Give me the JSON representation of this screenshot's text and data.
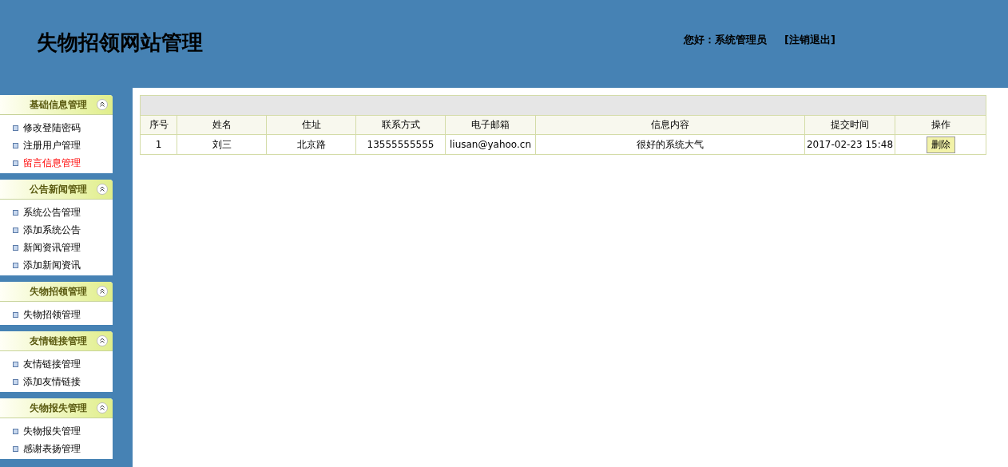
{
  "header": {
    "title": "失物招领网站管理",
    "greeting": "您好：系统管理员",
    "logout": "[注销退出]"
  },
  "sidebar": {
    "sections": [
      {
        "title": "基础信息管理",
        "expanded": true,
        "items": [
          {
            "label": "修改登陆密码",
            "selected": false
          },
          {
            "label": "注册用户管理",
            "selected": false
          },
          {
            "label": "留言信息管理",
            "selected": true
          }
        ]
      },
      {
        "title": "公告新闻管理",
        "expanded": true,
        "items": [
          {
            "label": "系统公告管理",
            "selected": false
          },
          {
            "label": "添加系统公告",
            "selected": false
          },
          {
            "label": "新闻资讯管理",
            "selected": false
          },
          {
            "label": "添加新闻资讯",
            "selected": false
          }
        ]
      },
      {
        "title": "失物招领管理",
        "expanded": true,
        "items": [
          {
            "label": "失物招领管理",
            "selected": false
          }
        ]
      },
      {
        "title": "友情链接管理",
        "expanded": true,
        "items": [
          {
            "label": "友情链接管理",
            "selected": false
          },
          {
            "label": "添加友情链接",
            "selected": false
          }
        ]
      },
      {
        "title": "失物报失管理",
        "expanded": true,
        "items": [
          {
            "label": "失物报失管理",
            "selected": false
          },
          {
            "label": "感谢表扬管理",
            "selected": false
          }
        ]
      }
    ]
  },
  "table": {
    "columns": [
      "序号",
      "姓名",
      "住址",
      "联系方式",
      "电子邮箱",
      "信息内容",
      "提交时间",
      "操作"
    ],
    "rows": [
      {
        "cells": [
          "1",
          "刘三",
          "北京路",
          "13555555555",
          "liusan@yahoo.cn",
          "很好的系统大气",
          "2017-02-23 15:48"
        ],
        "action": "删除"
      }
    ]
  }
}
